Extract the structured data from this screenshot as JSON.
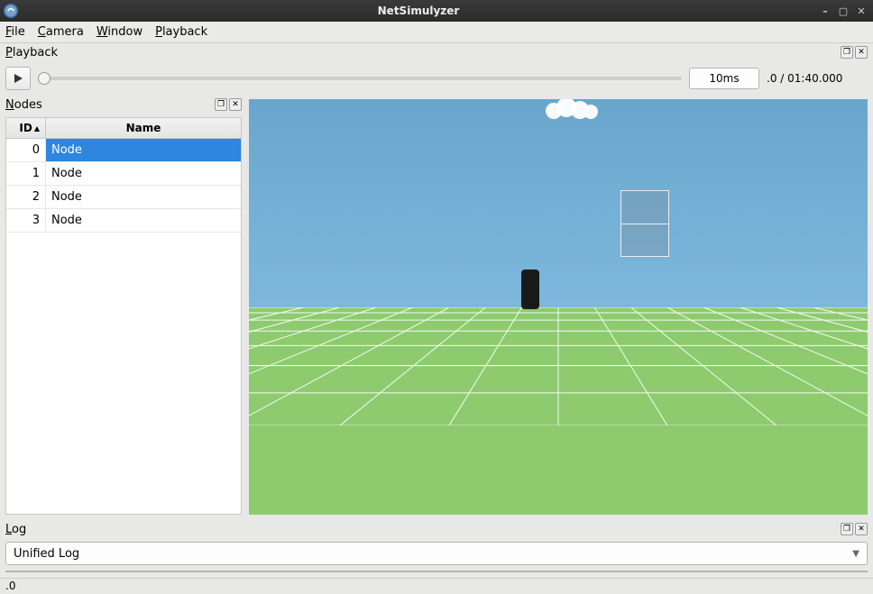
{
  "window": {
    "title": "NetSimulyzer"
  },
  "menu": {
    "file": "File",
    "camera": "Camera",
    "window": "Window",
    "playback": "Playback"
  },
  "playback_panel": {
    "title": "Playback",
    "step_value": "10ms",
    "time_current": ".0",
    "time_sep": " / ",
    "time_total": "01:40.000"
  },
  "nodes_panel": {
    "title": "Nodes",
    "col_id": "ID",
    "col_name": "Name",
    "rows": [
      {
        "id": "0",
        "name": "Node",
        "selected": true
      },
      {
        "id": "1",
        "name": "Node",
        "selected": false
      },
      {
        "id": "2",
        "name": "Node",
        "selected": false
      },
      {
        "id": "3",
        "name": "Node",
        "selected": false
      }
    ]
  },
  "log_panel": {
    "title": "Log",
    "selected": "Unified Log"
  },
  "status": {
    "text": ".0"
  }
}
